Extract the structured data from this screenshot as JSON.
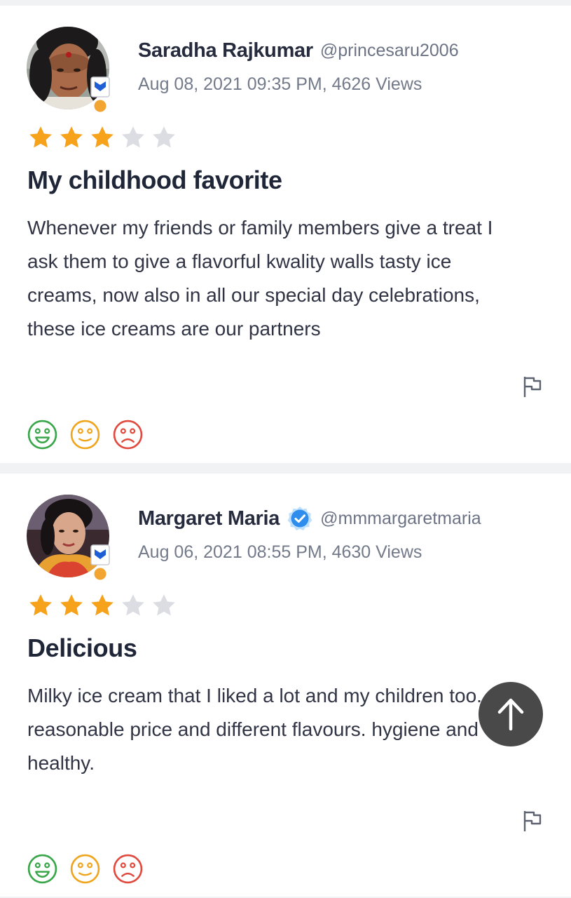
{
  "reviews": [
    {
      "name": "Saradha Rajkumar",
      "handle": "@princesaru2006",
      "verified": false,
      "meta": "Aug 08, 2021 09:35 PM, 4626 Views",
      "rating": 3,
      "rating_max": 5,
      "title": "My childhood favorite",
      "body": "Whenever my friends or family members give a treat I ask them to give a flavorful kwality walls tasty ice creams, now also in all our special day celebrations, these ice creams are our partners"
    },
    {
      "name": "Margaret Maria",
      "handle": "@mmmargaretmaria",
      "verified": true,
      "meta": "Aug 06, 2021 08:55 PM, 4630 Views",
      "rating": 3,
      "rating_max": 5,
      "title": "Delicious",
      "body": "Milky ice cream that I liked a lot and my children too. reasonable price and different flavours. hygiene and healthy."
    }
  ],
  "icons": {
    "star_filled": "star-filled-icon",
    "star_empty": "star-empty-icon",
    "flag": "flag-icon",
    "happy": "happy-face-icon",
    "neutral": "neutral-face-icon",
    "sad": "sad-face-icon",
    "verified": "verified-check-icon",
    "scroll_top": "arrow-up-icon"
  },
  "colors": {
    "star_filled": "#f7a21b",
    "star_empty": "#dcdde2",
    "happy": "#3aa64a",
    "neutral": "#f0a51e",
    "sad": "#e04a3f",
    "verified": "#2e8ded",
    "badge": "#1f5fd6"
  }
}
